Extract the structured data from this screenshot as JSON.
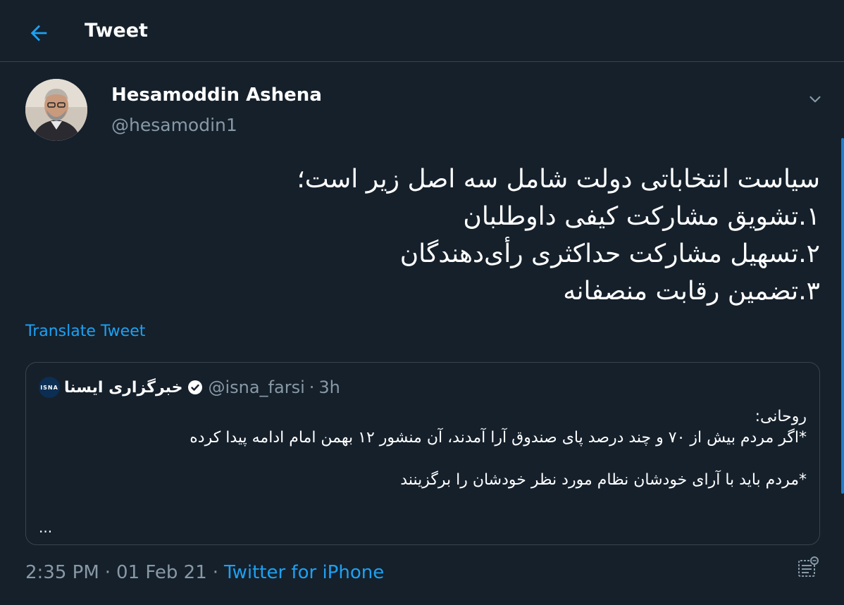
{
  "header": {
    "title": "Tweet",
    "back_icon": "arrow-left-icon"
  },
  "author": {
    "name": "Hesamoddin Ashena",
    "handle": "@hesamodin1",
    "avatar_icon": "profile-photo"
  },
  "tweet": {
    "text": "سیاست انتخاباتی دولت شامل سه اصل زیر است؛\n۱.تشویق مشارکت کیفی داوطلبان\n۲.تسهیل مشارکت حداکثری رأی‌دهندگان\n۳.تضمین رقابت منصفانه",
    "translate_label": "Translate Tweet"
  },
  "quote": {
    "avatar_text": "ISNA",
    "name": "خبرگزاری ایسنا",
    "handle": "@isna_farsi",
    "separator": "·",
    "time": "3h",
    "text": "روحانی:\n*اگر مردم بیش از ۷۰ و چند درصد پای صندوق آرا آمدند، آن منشور ۱۲ بهمن امام ادامه پیدا کرده\n\n*مردم باید با آرای خودشان نظام مورد نظر خودشان را برگزینند",
    "ellipsis": "..."
  },
  "footer": {
    "time": "2:35 PM",
    "sep1": "·",
    "date": "01 Feb 21",
    "sep2": "·",
    "source": "Twitter for iPhone"
  },
  "colors": {
    "background": "#15202b",
    "accent": "#1da1f2",
    "secondary_text": "#8899a6",
    "border": "#38444d"
  }
}
